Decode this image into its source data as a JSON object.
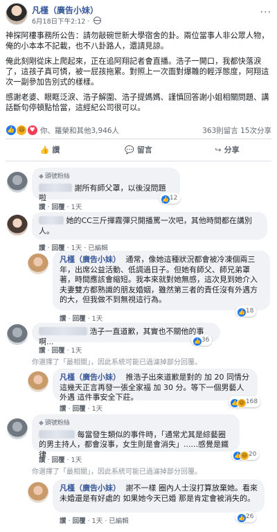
{
  "post": {
    "page_name": "凡槿（廣告小妹）",
    "timestamp": "6月18日下午2:12",
    "paragraphs": [
      "神探阿樓事務所公告：請勿敲碗世新大學宿舍的卦。兩位當事人非公眾人物，俺的小本本不記載，也不八卦路人，還請見諒。",
      "俺此刻剛從床上爬起來，正在追阿翔記者會直播。浩子一開口，我都快落淚了，這孩子真可憐，被一屁孩拖累。對照上一次面對爆雛的輕浮態度，阿翔這次一副參加告別式的樣樣。",
      "感謝老婆、眼眶泛淚、浩子解圍、浩子提媽媽、謹慎回答謝小姐相關問題、講話斷句停頓點恰當，這經紀公司很可以。"
    ],
    "reaction_count": "你、羅榮和其他3,946人",
    "comments_count": "363則留言",
    "shares_count": "15次分享"
  },
  "actions": {
    "like": "讚",
    "comment": "留言",
    "share": "分享"
  },
  "comments": [
    {
      "badge": "頭號粉絲",
      "text": "謝所有師父罩，以後沒問題啦",
      "like": "讚",
      "reply": "回覆",
      "time": "1天",
      "react_count": "12"
    },
    {
      "text": "她的CC三斤揮霧彈只開播罵一次吧，其他時間都在講別人。",
      "like": "讚",
      "reply": "回覆",
      "time": "1天",
      "edited": "已編輯"
    },
    {
      "name": "凡槿（廣告小妹）",
      "text": "通常，像她這種狀況都會被冷凍個兩三年，出席公益活動、低調過日子。但她有師父、師兄弟罩著，時間應該會縮短。我本來就對她無感，這次見到她介入夫妻雙方都熟識的朋友婚姻，雖然第三者的責任沒有外遇方的大，但我做不到無視這行為。",
      "like": "讚",
      "reply": "回覆",
      "time": "1天",
      "react_count": "18"
    },
    {
      "text": "浩子一直道歉，其實也不關他的事啊...",
      "like": "讚",
      "reply": "回覆",
      "time": "1天",
      "react_count": "36"
    },
    {
      "name": "凡槿（廣告小妹）",
      "text": "推浩子出來道歉是對的 加 20 同情分 這幾天正言再發一張全家福 加 30 分。等下一個男藝人外遇 這件事安全下莊。",
      "like": "讚",
      "reply": "回覆",
      "time": "1天",
      "react_count": "168"
    },
    {
      "badge": "頭號粉絲",
      "text": "每當發生類似的事件時，「通常尤其是綜藝圈的男主持人，都會沒事，女生則是會消失」......感覺是鐵律",
      "like": "讚",
      "reply": "回覆",
      "time": "1天",
      "react_count": "20"
    },
    {
      "name": "凡槿（廣告小妹）",
      "text": "謝不一樣 圈內人士沒打算放棄她。看來 未婚還是有好處的 如果她今天已婚 那是肯定會被消失的。",
      "like": "讚",
      "reply": "回覆",
      "time": "1天",
      "edited": "已編輯",
      "react_count": "26"
    }
  ],
  "hidden_notice_1": "你選擇了「最相關」，因此系統可能已過濾掉部分回覆。",
  "hidden_notice_2": "你選擇了「最相關」，因此系統可能已過濾掉部分回覆。",
  "colors": {
    "link": "#385898",
    "meta": "#606770",
    "bubble": "#f0f2f5"
  }
}
